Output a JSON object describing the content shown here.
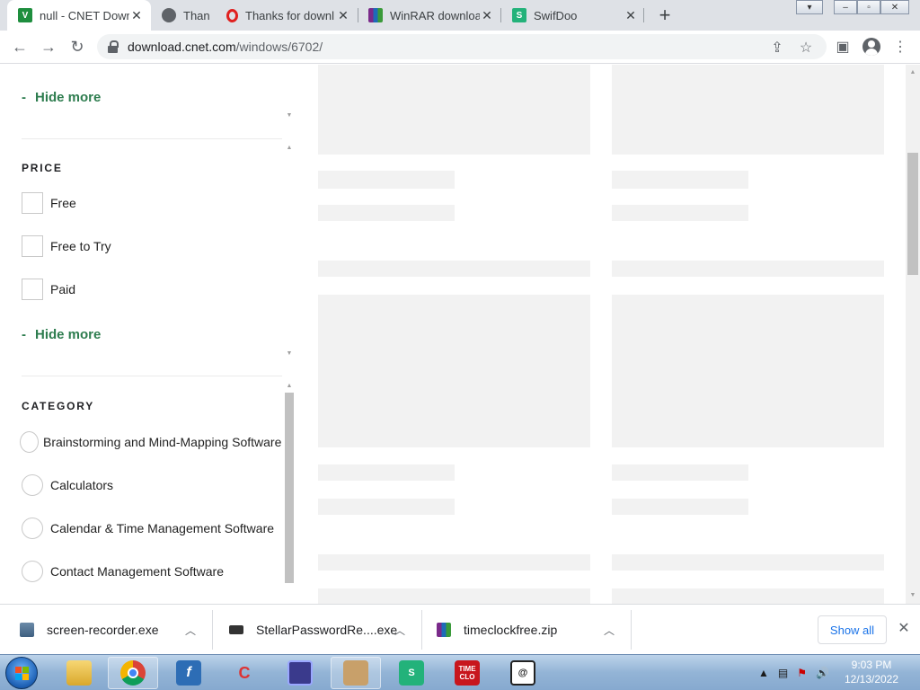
{
  "browser": {
    "tabs": [
      {
        "title": "null - CNET Down",
        "favicon": "green-v-icon",
        "active": true
      },
      {
        "title": "Than",
        "favicon": "globe-icon",
        "active": false
      },
      {
        "title": "Thanks for downl",
        "favicon": "opera-o-icon",
        "active": false
      },
      {
        "title": "WinRAR downloa",
        "favicon": "winrar-icon",
        "active": false
      },
      {
        "title": "SwifDoo",
        "favicon": "swifdoo-icon",
        "active": false
      }
    ],
    "new_tab_symbol": "+",
    "close_symbol": "✕",
    "url_domain": "download.cnet.com",
    "url_path": "/windows/6702/"
  },
  "sidebar": {
    "hide_more_label": "Hide more",
    "hide_more_dash": "-",
    "price": {
      "title": "PRICE",
      "options": [
        "Free",
        "Free to Try",
        "Paid"
      ],
      "hide_more_label": "Hide more"
    },
    "category": {
      "title": "CATEGORY",
      "options": [
        "Brainstorming and Mind-Mapping Software",
        "Calculators",
        "Calendar & Time Management Software",
        "Contact Management Software"
      ]
    }
  },
  "downloads": {
    "items": [
      {
        "name": "screen-recorder.exe",
        "icon": "installer-icon"
      },
      {
        "name": "StellarPasswordRe....exe",
        "icon": "installer-icon"
      },
      {
        "name": "timeclockfree.zip",
        "icon": "winrar-archive-icon"
      }
    ],
    "show_all_label": "Show all"
  },
  "taskbar": {
    "apps": [
      {
        "name": "file-explorer-icon"
      },
      {
        "name": "chrome-icon"
      },
      {
        "name": "fiddler-icon"
      },
      {
        "name": "ccleaner-icon"
      },
      {
        "name": "processor-app-icon"
      },
      {
        "name": "package-installer-icon"
      },
      {
        "name": "swifdoo-pdf-icon"
      },
      {
        "name": "timeclock-icon",
        "label": "TIME CLO"
      },
      {
        "name": "email-app-icon"
      }
    ],
    "time": "9:03 PM",
    "date": "12/13/2022"
  },
  "colors": {
    "accent_green": "#2e7d4f",
    "skeleton": "#f2f2f2",
    "link_blue": "#1a73e8"
  }
}
